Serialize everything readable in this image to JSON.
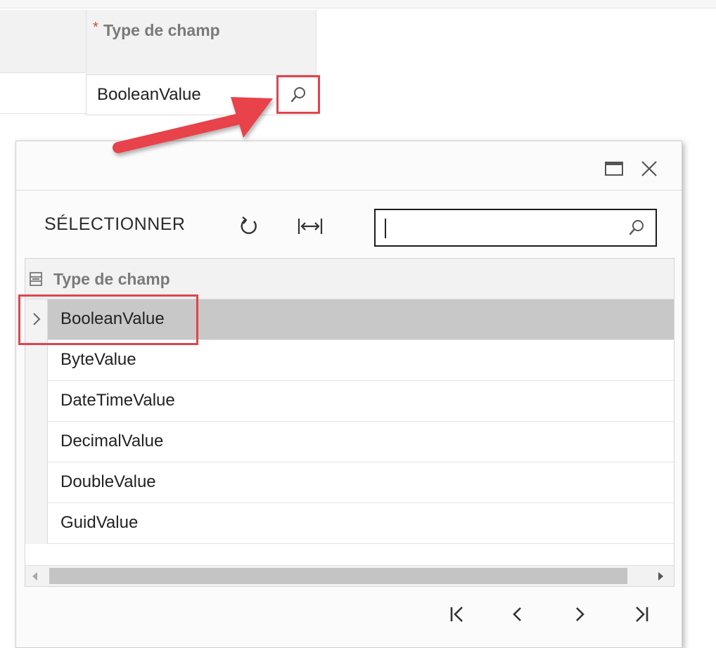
{
  "field": {
    "required_marker": "*",
    "header_label": "Type de champ",
    "value": "BooleanValue"
  },
  "lookup": {
    "toolbar": {
      "select_label": "SÉLECTIONNER",
      "search_value": ""
    },
    "column_header": "Type de champ",
    "rows": [
      "BooleanValue",
      "ByteValue",
      "DateTimeValue",
      "DecimalValue",
      "DoubleValue",
      "GuidValue"
    ],
    "selected_index": 0
  },
  "colors": {
    "highlight": "#e0444c",
    "selected_row": "#c8c8c8"
  },
  "icons": {
    "lookup": "magnifier-icon",
    "maximize": "maximize-icon",
    "close": "close-icon",
    "refresh": "refresh-icon",
    "fit": "fit-to-screen-icon",
    "column": "column-config-icon",
    "row_pointer": "chevron-right-icon",
    "pager": [
      "first-page-icon",
      "prev-page-icon",
      "next-page-icon",
      "last-page-icon"
    ]
  }
}
